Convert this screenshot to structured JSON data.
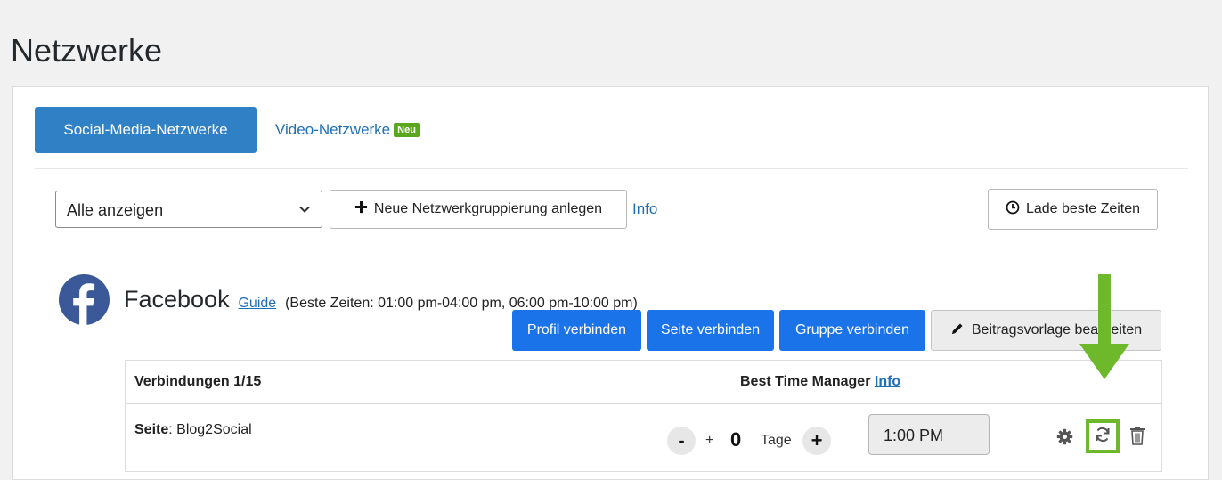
{
  "page": {
    "title": "Netzwerke"
  },
  "tabs": {
    "active_label": "Social-Media-Netzwerke",
    "video_label": "Video-Netzwerke",
    "new_badge": "Neu"
  },
  "toolbar": {
    "filter_value": "Alle anzeigen",
    "new_group_label": "Neue Netzwerkgruppierung anlegen",
    "info_link": "Info",
    "load_times_label": "Lade beste Zeiten"
  },
  "facebook": {
    "name": "Facebook",
    "guide_link": "Guide",
    "best_times": "(Beste Zeiten: 01:00 pm-04:00 pm, 06:00 pm-10:00 pm)",
    "buttons": {
      "profile": "Profil verbinden",
      "page": "Seite verbinden",
      "group": "Gruppe verbinden",
      "template": "Beitragsvorlage bearbeiten"
    },
    "table": {
      "connections_label": "Verbindungen 1/15",
      "btm_label": "Best Time Manager",
      "btm_info": "Info",
      "row": {
        "type_label": "Seite",
        "account_name": ": Blog2Social",
        "minus": "-",
        "plus_sign": "+",
        "days": "0",
        "days_unit": "Tage",
        "plus": "+",
        "time": "1:00 PM"
      }
    }
  },
  "colors": {
    "tab_active": "#2f80c4",
    "button_blue": "#1a73e8",
    "link": "#1f6fb8",
    "badge_green": "#5aa71e",
    "annotation_green": "#6db82b",
    "facebook_blue": "#3b5998"
  },
  "icons": [
    "chevron-down-icon",
    "plus-icon",
    "clock-icon",
    "facebook-logo-icon",
    "pencil-icon",
    "gear-icon",
    "refresh-icon",
    "trash-icon",
    "arrow-down-annotation"
  ]
}
